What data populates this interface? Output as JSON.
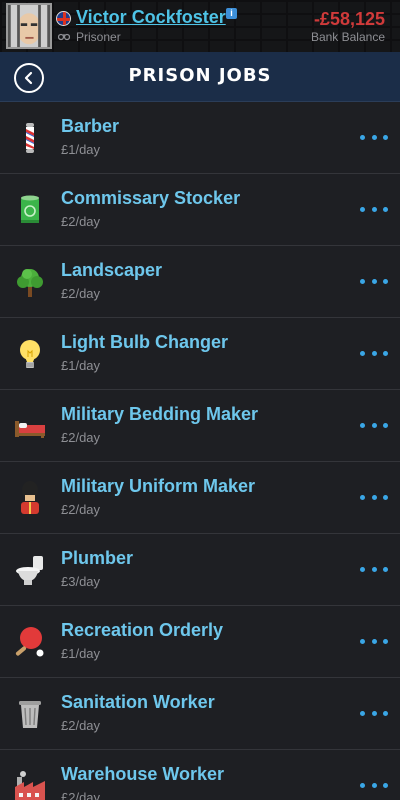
{
  "header": {
    "player_name": "Victor Cockfoster",
    "player_status": "Prisoner",
    "balance": "-£58,125",
    "balance_label": "Bank Balance",
    "info_badge": "i"
  },
  "nav": {
    "title": "PRISON JOBS"
  },
  "jobs": [
    {
      "title": "Barber",
      "pay": "£1/day",
      "icon": "barber-pole-icon"
    },
    {
      "title": "Commissary Stocker",
      "pay": "£2/day",
      "icon": "tin-can-icon"
    },
    {
      "title": "Landscaper",
      "pay": "£2/day",
      "icon": "tree-icon"
    },
    {
      "title": "Light Bulb Changer",
      "pay": "£1/day",
      "icon": "light-bulb-icon"
    },
    {
      "title": "Military Bedding Maker",
      "pay": "£2/day",
      "icon": "bed-icon"
    },
    {
      "title": "Military Uniform Maker",
      "pay": "£2/day",
      "icon": "royal-guard-icon"
    },
    {
      "title": "Plumber",
      "pay": "£3/day",
      "icon": "toilet-icon"
    },
    {
      "title": "Recreation Orderly",
      "pay": "£1/day",
      "icon": "ping-pong-icon"
    },
    {
      "title": "Sanitation Worker",
      "pay": "£2/day",
      "icon": "trash-can-icon"
    },
    {
      "title": "Warehouse Worker",
      "pay": "£2/day",
      "icon": "factory-icon"
    }
  ],
  "colors": {
    "accent": "#3aa6e6",
    "job_title": "#6ec7ec",
    "negative_balance": "#d03a3a",
    "navbar": "#1b2d48",
    "background": "#1e1f23"
  }
}
